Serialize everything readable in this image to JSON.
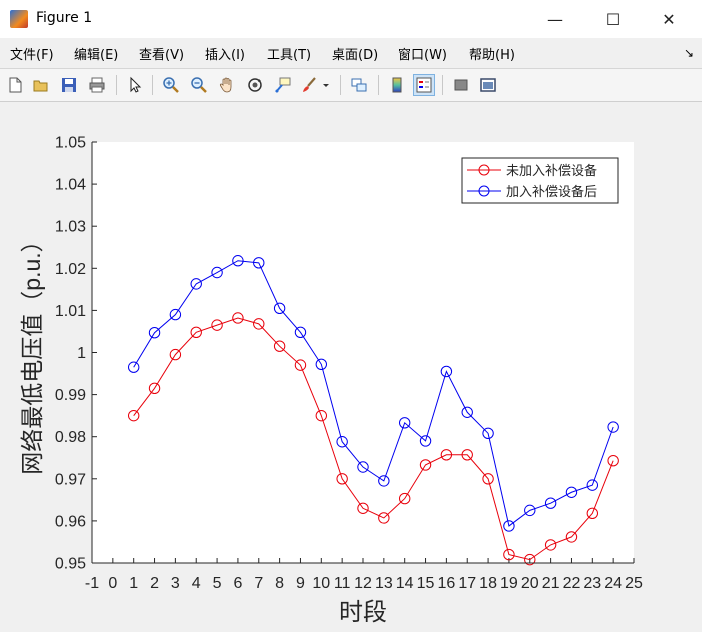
{
  "window": {
    "title": "Figure 1",
    "minimize": "—",
    "maximize": "☐",
    "close": "✕"
  },
  "menu": {
    "items": [
      "文件(F)",
      "编辑(E)",
      "查看(V)",
      "插入(I)",
      "工具(T)",
      "桌面(D)",
      "窗口(W)",
      "帮助(H)"
    ],
    "expand_glyph": "↘"
  },
  "toolbar": {
    "buttons": [
      "new-figure-icon",
      "open-file-icon",
      "save-icon",
      "print-icon",
      "pointer-icon",
      "zoom-in-icon",
      "zoom-out-icon",
      "pan-hand-icon",
      "rotate-3d-icon",
      "data-cursor-icon",
      "brush-icon",
      "brush-menu-icon",
      "link-plot-icon",
      "colorbar-icon",
      "legend-icon",
      "hide-plot-tools-icon",
      "show-plot-tools-icon"
    ]
  },
  "chart_data": {
    "type": "line",
    "xlabel": "时段",
    "ylabel": "网络最低电压值（p.u.）",
    "xlim": [
      -1,
      25
    ],
    "ylim": [
      0.95,
      1.05
    ],
    "x_ticks": [
      "-1",
      "0",
      "1",
      "2",
      "3",
      "4",
      "5",
      "6",
      "7",
      "8",
      "9",
      "10",
      "11",
      "12",
      "13",
      "14",
      "15",
      "16",
      "17",
      "18",
      "19",
      "20",
      "21",
      "22",
      "23",
      "24",
      "25"
    ],
    "y_ticks": [
      "0.95",
      "0.96",
      "0.97",
      "0.98",
      "0.99",
      "1",
      "1.01",
      "1.02",
      "1.03",
      "1.04",
      "1.05"
    ],
    "legend_position": "top-right",
    "grid": false,
    "marker": "circle",
    "x": [
      1,
      2,
      3,
      4,
      5,
      6,
      7,
      8,
      9,
      10,
      11,
      12,
      13,
      14,
      15,
      16,
      17,
      18,
      19,
      20,
      21,
      22,
      23,
      24
    ],
    "series": [
      {
        "name": "未加入补偿设备",
        "color": "#e8000b",
        "values": [
          0.985,
          0.9915,
          0.9995,
          1.0048,
          1.0065,
          1.0082,
          1.0068,
          1.0015,
          0.997,
          0.985,
          0.97,
          0.963,
          0.9607,
          0.9653,
          0.9733,
          0.9757,
          0.9757,
          0.97,
          0.952,
          0.9508,
          0.9543,
          0.9562,
          0.9618,
          0.9743
        ]
      },
      {
        "name": "加入补偿设备后",
        "color": "#0000f0",
        "values": [
          0.9965,
          1.0047,
          1.009,
          1.0163,
          1.019,
          1.0218,
          1.0213,
          1.0105,
          1.0048,
          0.9972,
          0.9788,
          0.9728,
          0.9695,
          0.9833,
          0.979,
          0.9955,
          0.9858,
          0.9808,
          0.9588,
          0.9625,
          0.9642,
          0.9668,
          0.9685,
          0.9823
        ]
      }
    ]
  }
}
